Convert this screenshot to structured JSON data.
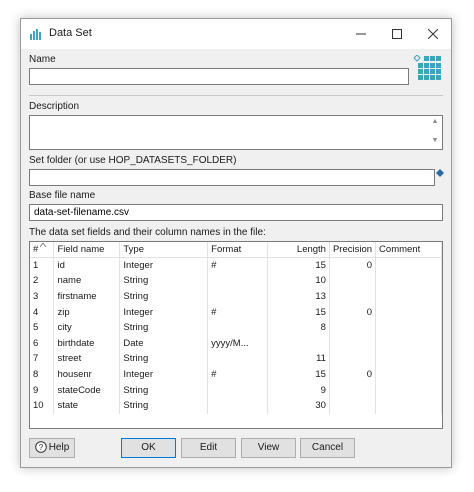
{
  "window": {
    "title": "Data Set"
  },
  "labels": {
    "name": "Name",
    "description": "Description",
    "set_folder": "Set folder (or use HOP_DATASETS_FOLDER)",
    "base_file_name": "Base file name",
    "fields_caption": "The data set fields and their column names in the file:"
  },
  "fields": {
    "name_value": "",
    "description_value": "",
    "set_folder_value": "",
    "base_file_name_value": "data-set-filename.csv"
  },
  "table": {
    "columns": [
      "#",
      "Field name",
      "Type",
      "Format",
      "Length",
      "Precision",
      "Comment"
    ],
    "rows": [
      [
        "1",
        "id",
        "Integer",
        "#",
        "15",
        "0",
        ""
      ],
      [
        "2",
        "name",
        "String",
        "",
        "10",
        "",
        ""
      ],
      [
        "3",
        "firstname",
        "String",
        "",
        "13",
        "",
        ""
      ],
      [
        "4",
        "zip",
        "Integer",
        "#",
        "15",
        "0",
        ""
      ],
      [
        "5",
        "city",
        "String",
        "",
        "8",
        "",
        ""
      ],
      [
        "6",
        "birthdate",
        "Date",
        "yyyy/M...",
        "",
        "",
        ""
      ],
      [
        "7",
        "street",
        "String",
        "",
        "11",
        "",
        ""
      ],
      [
        "8",
        "housenr",
        "Integer",
        "#",
        "15",
        "0",
        ""
      ],
      [
        "9",
        "stateCode",
        "String",
        "",
        "9",
        "",
        ""
      ],
      [
        "10",
        "state",
        "String",
        "",
        "30",
        "",
        ""
      ]
    ]
  },
  "buttons": {
    "help": "Help",
    "ok": "OK",
    "edit": "Edit",
    "view": "View",
    "cancel": "Cancel"
  },
  "icons": {
    "title": "dataset-icon",
    "dataset_large": "dataset-grid-icon",
    "help": "question-circle-icon",
    "folder_variable": "diamond-variable-icon"
  },
  "colors": {
    "accent": "#3aa6b9",
    "ok_border": "#0078d7"
  }
}
